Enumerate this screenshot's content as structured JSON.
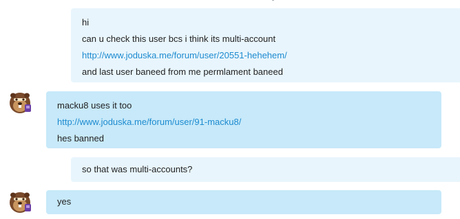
{
  "conversation": {
    "messages": [
      {
        "sender": "outgoing",
        "lines": [
          {
            "text": "hi",
            "type": "text"
          },
          {
            "text": "can u check this user bcs i think its multi-account",
            "type": "text"
          },
          {
            "text": "http://www.joduska.me/forum/user/20551-hehehem/",
            "type": "link"
          },
          {
            "text": "and last user baneed from me permlament baneed",
            "type": "text"
          }
        ]
      },
      {
        "sender": "incoming",
        "avatar_icon": "beaver-avatar-icon",
        "lines": [
          {
            "text": "macku8 uses it too",
            "type": "text"
          },
          {
            "text": "http://www.joduska.me/forum/user/91-macku8/",
            "type": "link"
          },
          {
            "text": "hes banned",
            "type": "text"
          }
        ]
      },
      {
        "sender": "outgoing",
        "lines": [
          {
            "text": "so that was multi-accounts?",
            "type": "text"
          }
        ]
      },
      {
        "sender": "incoming",
        "avatar_icon": "beaver-avatar-icon",
        "lines": [
          {
            "text": "yes",
            "type": "text"
          }
        ]
      }
    ]
  },
  "colors": {
    "outgoing_bubble": "#e8f5fc",
    "incoming_bubble": "#c7e9f9",
    "link": "#1d8bd0",
    "text": "#222222"
  }
}
